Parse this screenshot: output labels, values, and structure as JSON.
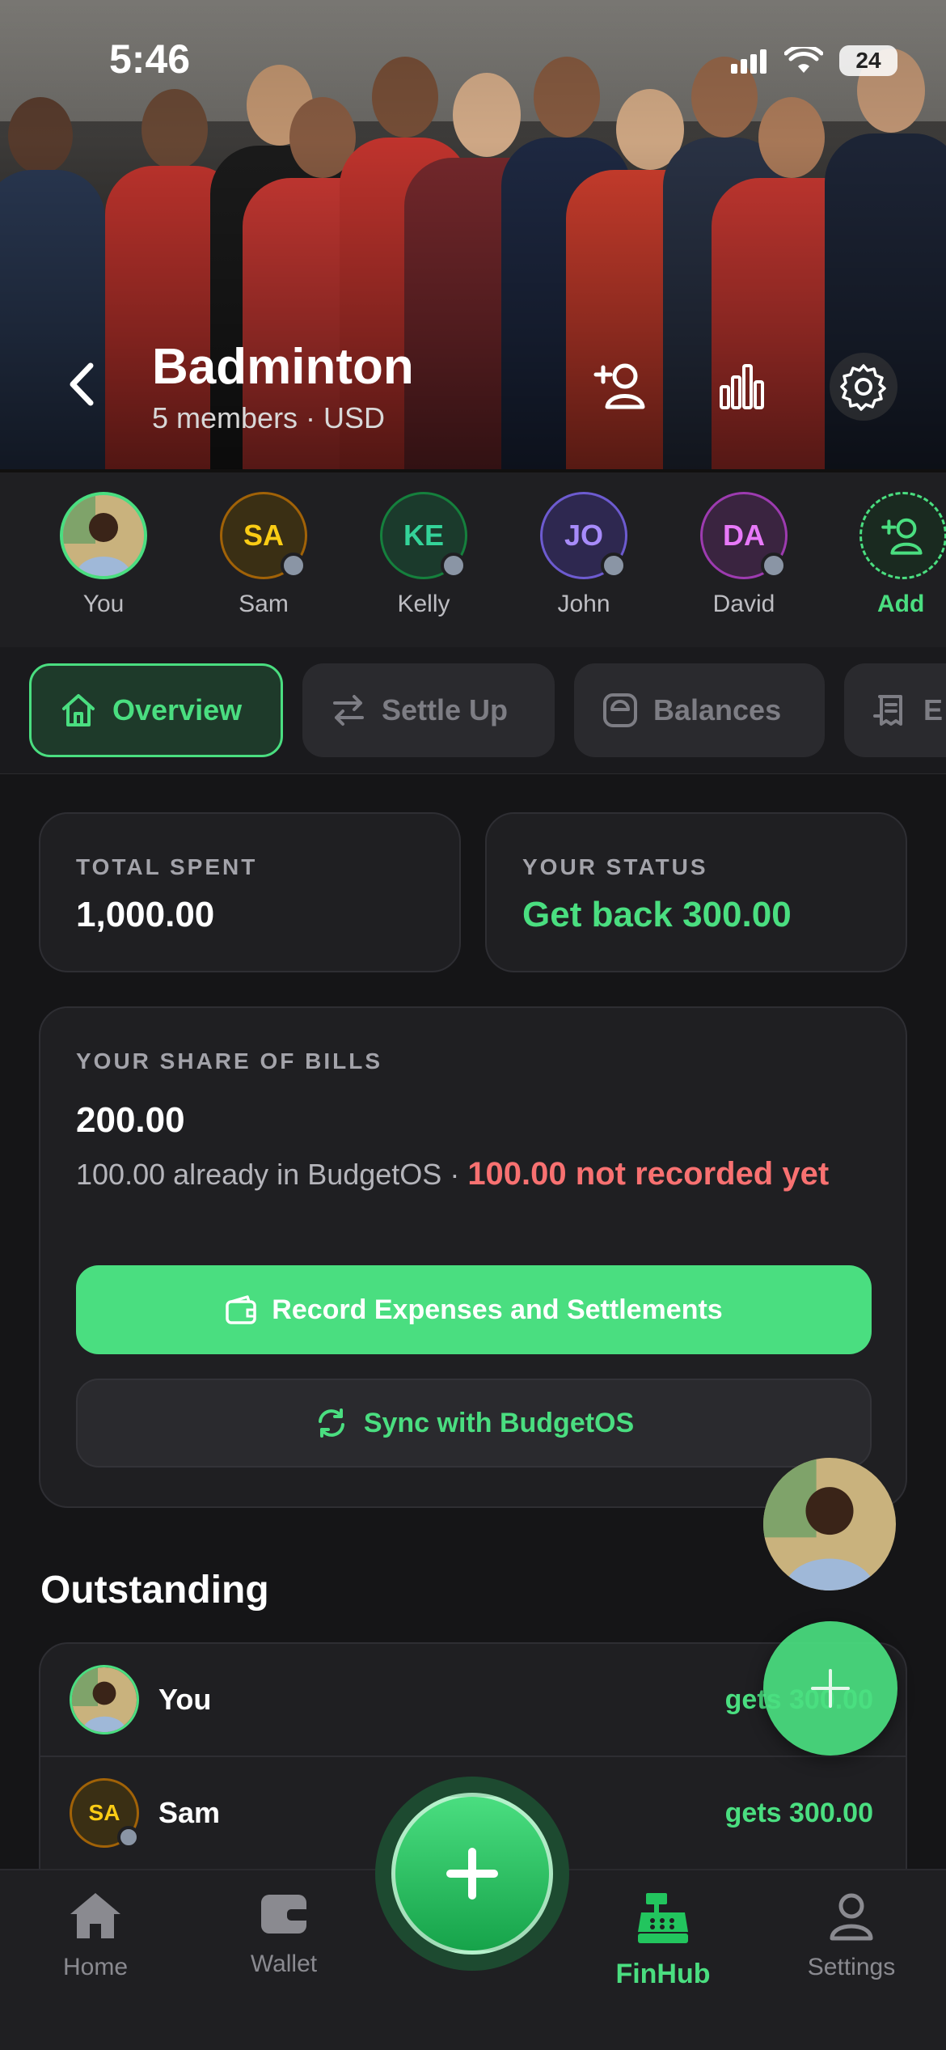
{
  "status_bar": {
    "time": "5:46",
    "battery": "24"
  },
  "header": {
    "title": "Badminton",
    "subtitle": "5 members · USD"
  },
  "members": [
    {
      "name": "You",
      "initials": "",
      "color": "#4ade80"
    },
    {
      "name": "Sam",
      "initials": "SA",
      "color": "#eab308"
    },
    {
      "name": "Kelly",
      "initials": "KE",
      "color": "#34d399"
    },
    {
      "name": "John",
      "initials": "JO",
      "color": "#a78bfa"
    },
    {
      "name": "David",
      "initials": "DA",
      "color": "#e879f9"
    }
  ],
  "add_member_label": "Add",
  "tabs": [
    {
      "label": "Overview",
      "icon": "home-icon",
      "active": true
    },
    {
      "label": "Settle Up",
      "icon": "transfer-icon",
      "active": false
    },
    {
      "label": "Balances",
      "icon": "scale-icon",
      "active": false
    },
    {
      "label": "E",
      "icon": "receipt-icon",
      "active": false
    }
  ],
  "summary": {
    "total_spent_label": "TOTAL SPENT",
    "total_spent_value": "1,000.00",
    "status_label": "YOUR STATUS",
    "status_value": "Get back 300.00"
  },
  "share": {
    "label": "YOUR SHARE OF BILLS",
    "value": "200.00",
    "note_prefix": "100.00 already in BudgetOS · ",
    "note_highlight": "100.00 not recorded yet",
    "record_button": "Record Expenses and Settlements",
    "sync_button": "Sync with BudgetOS"
  },
  "outstanding": {
    "title": "Outstanding",
    "rows": [
      {
        "name": "You",
        "amount": "gets 300.00"
      },
      {
        "name": "Sam",
        "initials": "SA",
        "amount": "gets 300.00"
      }
    ]
  },
  "nav": {
    "items": [
      {
        "label": "Home",
        "icon": "home-icon"
      },
      {
        "label": "Wallet",
        "icon": "wallet-icon"
      },
      {
        "label": "FinHub",
        "icon": "cash-register-icon",
        "active": true
      },
      {
        "label": "Settings",
        "icon": "user-icon"
      }
    ]
  },
  "colors": {
    "accent": "#4ade80",
    "warning": "#f87171",
    "background": "#151517"
  }
}
